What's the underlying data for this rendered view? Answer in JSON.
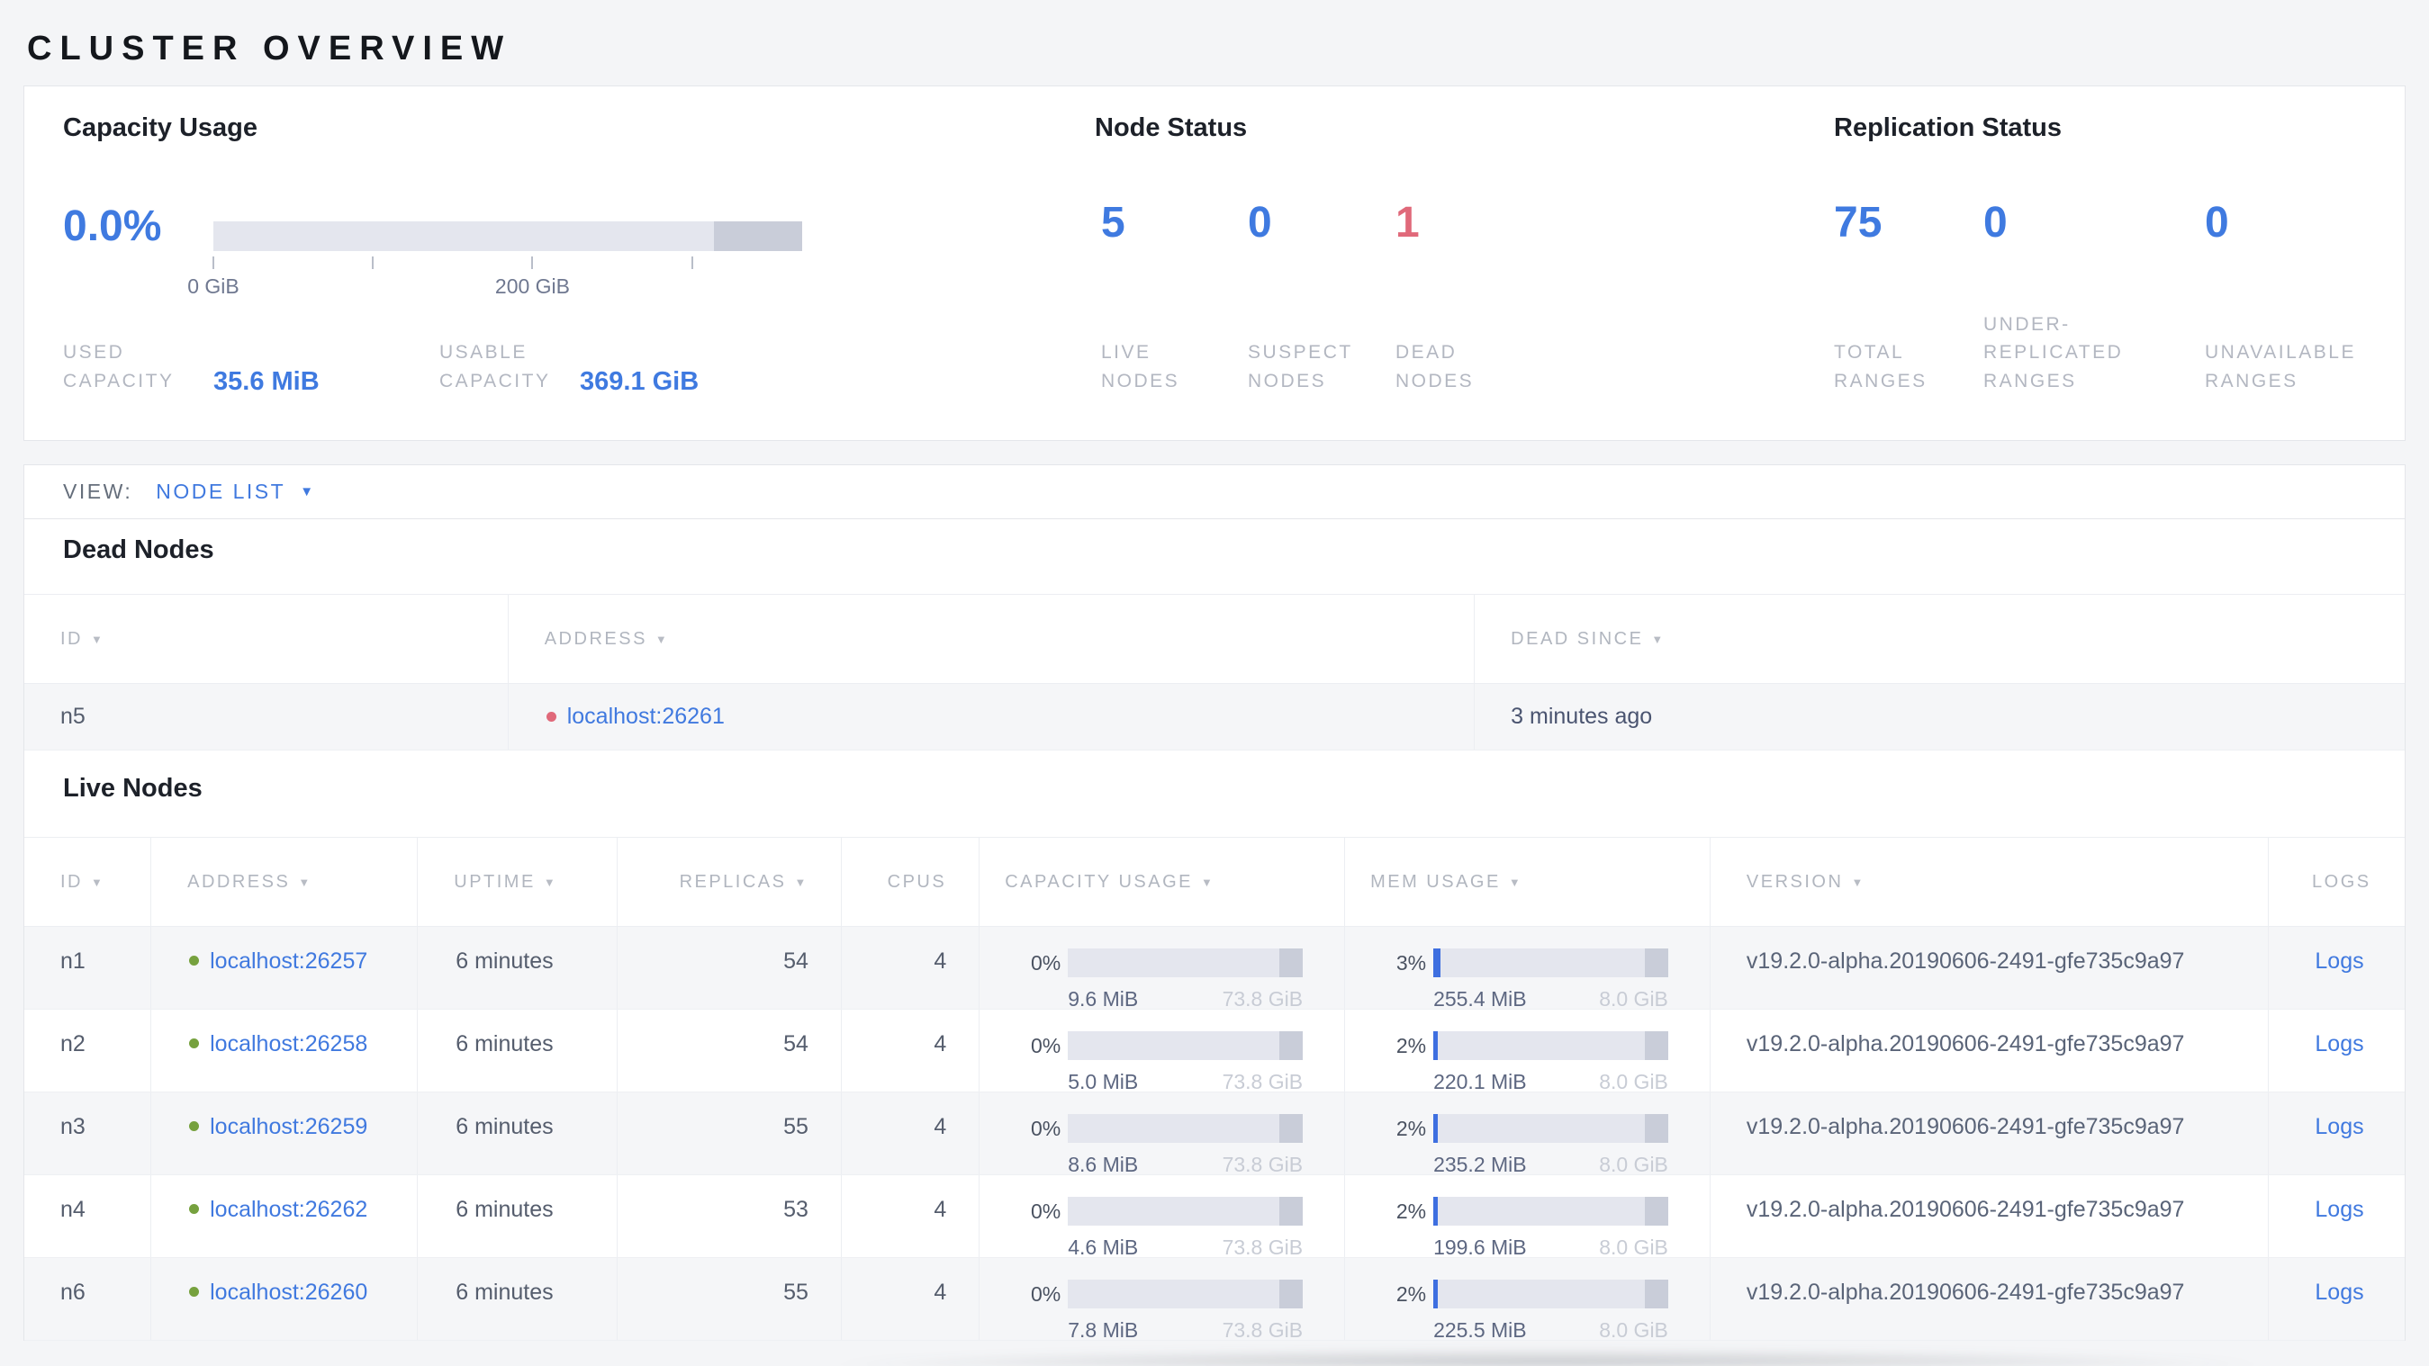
{
  "page": {
    "title": "CLUSTER OVERVIEW"
  },
  "icons": {
    "sort_desc": "▼",
    "dropdown": "▼"
  },
  "colors": {
    "accent": "#3f7ae0",
    "danger": "#e0697a",
    "live_dot": "#76a13e",
    "dead_dot": "#e0697a"
  },
  "bars": {
    "summary_dark_start": 0.85,
    "row_dark_start": 0.9
  },
  "summary": {
    "capacity": {
      "title": "Capacity Usage",
      "percent": "0.0%",
      "used_frac": 0,
      "axis": {
        "ticks": [
          {
            "label": "0 GiB",
            "frac": 0
          },
          {
            "label": "",
            "frac": 0.271
          },
          {
            "label": "200 GiB",
            "frac": 0.542
          },
          {
            "label": "",
            "frac": 0.813
          }
        ]
      },
      "stats": [
        {
          "label": "USED CAPACITY",
          "value": "35.6 MiB"
        },
        {
          "label": "USABLE CAPACITY",
          "value": "369.1 GiB"
        }
      ]
    },
    "node_status": {
      "title": "Node Status",
      "stats": [
        {
          "value": "5",
          "label": "LIVE NODES",
          "tone": "accent"
        },
        {
          "value": "0",
          "label": "SUSPECT NODES",
          "tone": "accent"
        },
        {
          "value": "1",
          "label": "DEAD NODES",
          "tone": "danger"
        }
      ]
    },
    "replication": {
      "title": "Replication Status",
      "stats": [
        {
          "value": "75",
          "label": "TOTAL RANGES",
          "tone": "accent"
        },
        {
          "value": "0",
          "label": "UNDER-REPLICATED RANGES",
          "tone": "accent"
        },
        {
          "value": "0",
          "label": "UNAVAILABLE RANGES",
          "tone": "accent"
        }
      ]
    }
  },
  "view_bar": {
    "label": "VIEW:",
    "selected": "NODE LIST"
  },
  "dead_nodes": {
    "title": "Dead Nodes",
    "columns": [
      {
        "label": "ID",
        "sortable": true
      },
      {
        "label": "ADDRESS",
        "sortable": true
      },
      {
        "label": "DEAD SINCE",
        "sortable": true
      }
    ],
    "rows": [
      {
        "id": "n5",
        "address": "localhost:26261",
        "dead_since": "3 minutes ago"
      }
    ]
  },
  "live_nodes": {
    "title": "Live Nodes",
    "columns": [
      {
        "label": "ID",
        "sortable": true
      },
      {
        "label": "ADDRESS",
        "sortable": true
      },
      {
        "label": "UPTIME",
        "sortable": true
      },
      {
        "label": "REPLICAS",
        "sortable": true
      },
      {
        "label": "CPUS",
        "sortable": false
      },
      {
        "label": "CAPACITY USAGE",
        "sortable": true
      },
      {
        "label": "MEM USAGE",
        "sortable": true
      },
      {
        "label": "VERSION",
        "sortable": true
      },
      {
        "label": "LOGS",
        "sortable": false
      }
    ],
    "logs_label": "Logs",
    "rows": [
      {
        "id": "n1",
        "address": "localhost:26257",
        "uptime": "6 minutes",
        "replicas": "54",
        "cpus": "4",
        "capacity": {
          "percent": "0%",
          "frac": 0,
          "used": "9.6 MiB",
          "total": "73.8 GiB"
        },
        "mem": {
          "percent": "3%",
          "frac": 0.03,
          "used": "255.4 MiB",
          "total": "8.0 GiB"
        },
        "version": "v19.2.0-alpha.20190606-2491-gfe735c9a97",
        "logs": "Logs"
      },
      {
        "id": "n2",
        "address": "localhost:26258",
        "uptime": "6 minutes",
        "replicas": "54",
        "cpus": "4",
        "capacity": {
          "percent": "0%",
          "frac": 0,
          "used": "5.0 MiB",
          "total": "73.8 GiB"
        },
        "mem": {
          "percent": "2%",
          "frac": 0.02,
          "used": "220.1 MiB",
          "total": "8.0 GiB"
        },
        "version": "v19.2.0-alpha.20190606-2491-gfe735c9a97",
        "logs": "Logs"
      },
      {
        "id": "n3",
        "address": "localhost:26259",
        "uptime": "6 minutes",
        "replicas": "55",
        "cpus": "4",
        "capacity": {
          "percent": "0%",
          "frac": 0,
          "used": "8.6 MiB",
          "total": "73.8 GiB"
        },
        "mem": {
          "percent": "2%",
          "frac": 0.02,
          "used": "235.2 MiB",
          "total": "8.0 GiB"
        },
        "version": "v19.2.0-alpha.20190606-2491-gfe735c9a97",
        "logs": "Logs"
      },
      {
        "id": "n4",
        "address": "localhost:26262",
        "uptime": "6 minutes",
        "replicas": "53",
        "cpus": "4",
        "capacity": {
          "percent": "0%",
          "frac": 0,
          "used": "4.6 MiB",
          "total": "73.8 GiB"
        },
        "mem": {
          "percent": "2%",
          "frac": 0.02,
          "used": "199.6 MiB",
          "total": "8.0 GiB"
        },
        "version": "v19.2.0-alpha.20190606-2491-gfe735c9a97",
        "logs": "Logs"
      },
      {
        "id": "n6",
        "address": "localhost:26260",
        "uptime": "6 minutes",
        "replicas": "55",
        "cpus": "4",
        "capacity": {
          "percent": "0%",
          "frac": 0,
          "used": "7.8 MiB",
          "total": "73.8 GiB"
        },
        "mem": {
          "percent": "2%",
          "frac": 0.02,
          "used": "225.5 MiB",
          "total": "8.0 GiB"
        },
        "version": "v19.2.0-alpha.20190606-2491-gfe735c9a97",
        "logs": "Logs"
      }
    ]
  }
}
